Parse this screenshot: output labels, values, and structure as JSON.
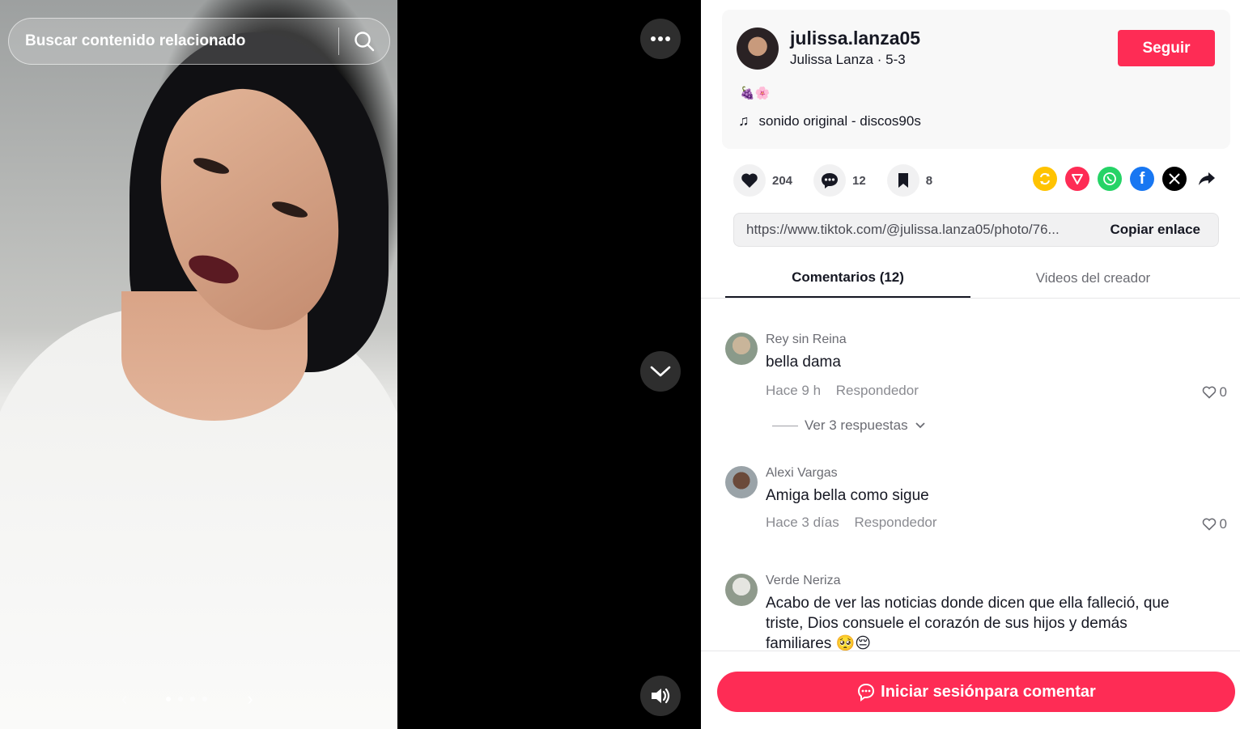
{
  "search": {
    "placeholder": "Buscar contenido relacionado"
  },
  "carousel": {
    "total": 4,
    "active_index": 0
  },
  "post": {
    "username": "julissa.lanza05",
    "nickname_date": "Julissa Lanza · 5-3",
    "follow_label": "Seguir",
    "emojis": "🍇🌸",
    "music": "sonido original - discos90s"
  },
  "stats": {
    "likes": "204",
    "comments": "12",
    "saves": "8"
  },
  "share_icons": [
    "repost-icon",
    "send-icon",
    "whatsapp-icon",
    "facebook-icon",
    "x-icon",
    "share-arrow-icon"
  ],
  "colors": {
    "accent": "#fe2c55",
    "repost": "#ffc300",
    "send": "#fe2c55",
    "whatsapp": "#25d366",
    "facebook": "#1877f2",
    "x": "#000000"
  },
  "link": {
    "url": "https://www.tiktok.com/@julissa.lanza05/photo/76...",
    "copy_label": "Copiar enlace"
  },
  "tabs": [
    {
      "label": "Comentarios (12)"
    },
    {
      "label": "Videos del creador"
    }
  ],
  "comments": [
    {
      "name": "Rey sin Reina",
      "text": "bella dama",
      "time": "Hace 9 h",
      "reply": "Respondedor",
      "likes": "0",
      "view_replies": "Ver 3 respuestas"
    },
    {
      "name": "Alexi Vargas",
      "text": "Amiga bella como sigue",
      "time": "Hace 3 días",
      "reply": "Respondedor",
      "likes": "0"
    },
    {
      "name": "Verde Neriza",
      "text": "Acabo de ver las noticias donde dicen que ella falleció, que triste, Dios consuele el corazón de sus hijos y demás familiares 🥺😔"
    }
  ],
  "login_label": "Iniciar sesiónpara comentar"
}
